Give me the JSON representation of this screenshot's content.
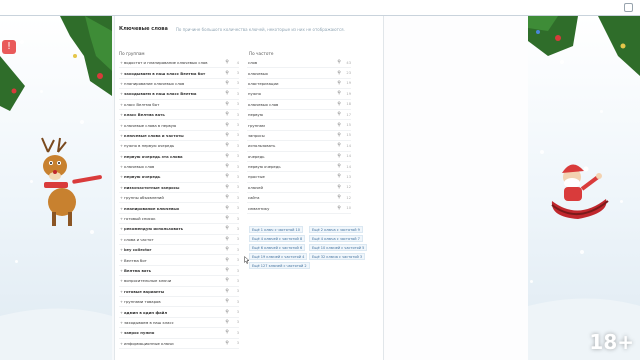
{
  "app": {
    "badge": "!",
    "panel_title": "Ключевые слова",
    "panel_hint": "По причине большого количества ключей, некоторые из них не отображаются.",
    "col_left": "По группам",
    "col_right": "По частоте",
    "age_label": "18+"
  },
  "left_rows": [
    {
      "label": "водостат и планирование ключевых слов",
      "bold": false,
      "num": "4"
    },
    {
      "label": "заходываем в наш класс Велтма бот",
      "bold": true,
      "num": "3"
    },
    {
      "label": "планирование ключевых слов",
      "bold": false,
      "num": "3"
    },
    {
      "label": "заходываем в наш класс Велтма",
      "bold": true,
      "num": "3"
    },
    {
      "label": "класс Велтма бот",
      "bold": false,
      "num": "3"
    },
    {
      "label": "класс Велтма вать",
      "bold": true,
      "num": "3"
    },
    {
      "label": "ключевые слова в первую",
      "bold": false,
      "num": "3"
    },
    {
      "label": "ключевые слова и частоты",
      "bold": true,
      "num": "3"
    },
    {
      "label": "нужно в первую очередь",
      "bold": false,
      "num": "3"
    },
    {
      "label": "первую очередь эта слова",
      "bold": true,
      "num": "3"
    },
    {
      "label": "ключевых слов",
      "bold": false,
      "num": "3"
    },
    {
      "label": "первую очередь",
      "bold": true,
      "num": "3"
    },
    {
      "label": "низкочастотные запросы",
      "bold": true,
      "num": "3"
    },
    {
      "label": "группы объявлений",
      "bold": false,
      "num": "3"
    },
    {
      "label": "планирование ключевых",
      "bold": true,
      "num": "3"
    },
    {
      "label": "готовый список",
      "bold": false,
      "num": "3"
    },
    {
      "label": "рекомендую использовать",
      "bold": true,
      "num": "3"
    },
    {
      "label": "слова и частот",
      "bold": false,
      "num": "3"
    },
    {
      "label": "key collector",
      "bold": true,
      "num": "3"
    },
    {
      "label": "Велтма бот",
      "bold": false,
      "num": "3"
    },
    {
      "label": "Велтма вать",
      "bold": true,
      "num": "3"
    },
    {
      "label": "вопросительные ключи",
      "bold": false,
      "num": "3"
    },
    {
      "label": "готовые варианты",
      "bold": true,
      "num": "3"
    },
    {
      "label": "группами товаров",
      "bold": false,
      "num": "3"
    },
    {
      "label": "админ в один файл",
      "bold": true,
      "num": "3"
    },
    {
      "label": "заходываем в наш класс",
      "bold": false,
      "num": "3"
    },
    {
      "label": "запрос нужно",
      "bold": true,
      "num": "3"
    },
    {
      "label": "информационные ключи",
      "bold": false,
      "num": "3"
    }
  ],
  "right_rows": [
    {
      "label": "слов",
      "num": "43"
    },
    {
      "label": "ключевых",
      "num": "23"
    },
    {
      "label": "кластеризации",
      "num": "19"
    },
    {
      "label": "нужно",
      "num": "19"
    },
    {
      "label": "ключевых слов",
      "num": "18"
    },
    {
      "label": "первую",
      "num": "17"
    },
    {
      "label": "группам",
      "num": "15"
    },
    {
      "label": "запросы",
      "num": "15"
    },
    {
      "label": "использовать",
      "num": "14"
    },
    {
      "label": "очередь",
      "num": "14"
    },
    {
      "label": "первую очередь",
      "num": "14"
    },
    {
      "label": "простые",
      "num": "13"
    },
    {
      "label": "ключей",
      "num": "12"
    },
    {
      "label": "сайта",
      "num": "12"
    },
    {
      "label": "семантику",
      "num": "10"
    }
  ],
  "more": [
    {
      "text": "Ещё 1 ключ с частотой 10"
    },
    {
      "text": "Ещё 2 ключа с частотой 9"
    },
    {
      "text": "Ещё 4 ключей с частотой 8"
    },
    {
      "text": "Ещё 4 ключа с частотой 7"
    },
    {
      "text": "Ещё 6 ключей с частотой 6"
    },
    {
      "text": "Ещё 10 ключей с частотой 5"
    },
    {
      "text": "Ещё 19 ключей с частотой 4"
    },
    {
      "text": "Ещё 32 ключа с частотой 3"
    },
    {
      "text": "Ещё 127 ключей с частотой 2"
    }
  ],
  "colors": {
    "accent": "#3d6e9c",
    "badge": "#e95a5a"
  },
  "icons": {
    "row_plus": "+",
    "attach": "🔗"
  }
}
